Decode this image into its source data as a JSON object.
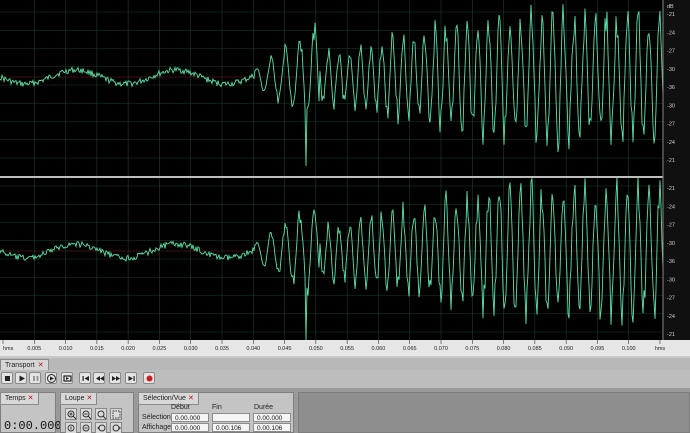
{
  "waveform": {
    "db_unit": "dB",
    "db_ticks": [
      "-21",
      "-24",
      "-27",
      "-30",
      "-36",
      "-30",
      "-27",
      "-24",
      "-21"
    ],
    "db_ticks_bottom": [
      "-21",
      "-24",
      "-27",
      "-30",
      "-36",
      "-30",
      "-27",
      "-24",
      "-21",
      "dB"
    ],
    "time_unit": "hms",
    "time_ticks": [
      "hms",
      "0.005",
      "0.010",
      "0.015",
      "0.020",
      "0.025",
      "0.030",
      "0.035",
      "0.040",
      "0.045",
      "0.050",
      "0.055",
      "0.060",
      "0.065",
      "0.070",
      "0.075",
      "0.080",
      "0.085",
      "0.090",
      "0.095",
      "0.100",
      "hms"
    ],
    "colors": {
      "wave": "#5de0a6",
      "background": "#000000",
      "center_line": "#7a2020",
      "grid": "#1f3a30"
    }
  },
  "transport": {
    "tab_label": "Transport",
    "buttons": [
      "stop-icon",
      "play-icon",
      "pause-icon",
      "play-from-cursor-icon",
      "loop-icon",
      "go-to-start-icon",
      "rewind-icon",
      "fast-forward-icon",
      "go-to-end-icon",
      "record-icon"
    ]
  },
  "time_panel": {
    "tab_label": "Temps",
    "value": "0:00.000"
  },
  "zoom_panel": {
    "tab_label": "Loupe"
  },
  "selection_panel": {
    "tab_label": "Sélection/Vue",
    "headers": {
      "start": "Début",
      "end": "Fin",
      "duration": "Durée"
    },
    "rows": [
      {
        "label": "Sélection",
        "start": "0.00.000",
        "end": "",
        "duration": "0.00.000"
      },
      {
        "label": "Affichage",
        "start": "0.00.000",
        "end": "0.00.106",
        "duration": "0.00.106"
      }
    ]
  }
}
